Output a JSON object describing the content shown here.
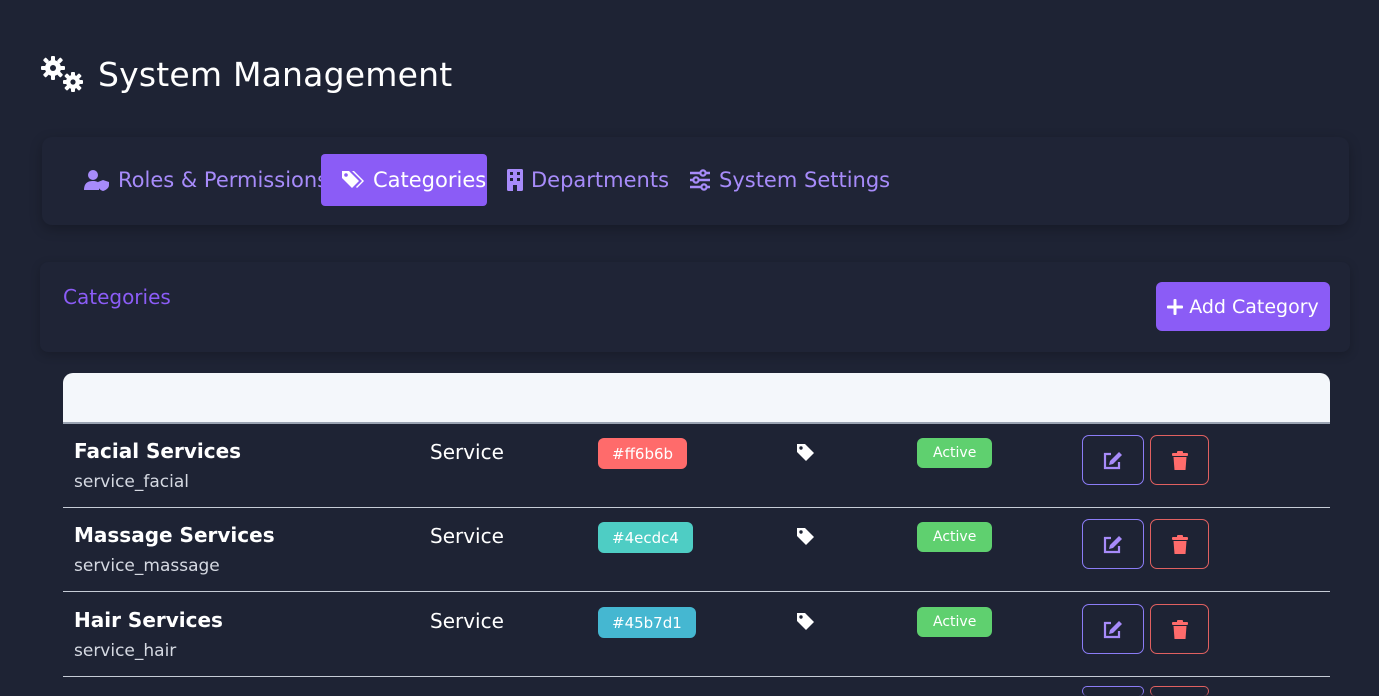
{
  "header": {
    "title": "System Management",
    "icon": "gears-icon"
  },
  "tabs": [
    {
      "label": "Roles & Permissions",
      "icon": "user-shield-icon",
      "active": false
    },
    {
      "label": "Categories",
      "icon": "tags-icon",
      "active": true
    },
    {
      "label": "Departments",
      "icon": "building-icon",
      "active": false
    },
    {
      "label": "System Settings",
      "icon": "sliders-icon",
      "active": false
    }
  ],
  "categories_panel": {
    "title": "Categories",
    "add_button_label": "Add Category"
  },
  "rows": [
    {
      "name": "Facial Services",
      "code": "service_facial",
      "type": "Service",
      "color": "#ff6b6b",
      "status": "Active"
    },
    {
      "name": "Massage Services",
      "code": "service_massage",
      "type": "Service",
      "color": "#4ecdc4",
      "status": "Active"
    },
    {
      "name": "Hair Services",
      "code": "service_hair",
      "type": "Service",
      "color": "#45b7d1",
      "status": "Active"
    }
  ],
  "colors": {
    "background": "#1e2334",
    "accent": "#8b5cf6",
    "accent_text": "#a78bfa",
    "active_status": "#5fd06f",
    "danger": "#ff6b6b"
  }
}
